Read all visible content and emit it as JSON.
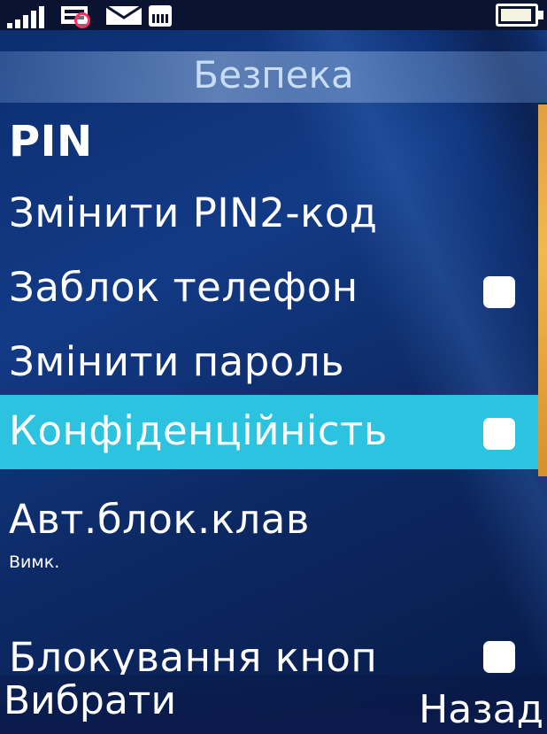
{
  "status_bar": {
    "icons": [
      "signal-icon",
      "network-icon",
      "mute-icon",
      "envelope-icon",
      "sim-card-icon",
      "battery-icon"
    ]
  },
  "header": {
    "title": "Безпека"
  },
  "menu": {
    "items": [
      {
        "label": "PIN",
        "has_checkbox": false
      },
      {
        "label": "Змінити PIN2-код",
        "has_checkbox": false
      },
      {
        "label": "Заблок телефон",
        "has_checkbox": true,
        "checked": false
      },
      {
        "label": "Змінити пароль",
        "has_checkbox": false
      },
      {
        "label": "Конфіденційність",
        "has_checkbox": true,
        "checked": false,
        "selected": true
      },
      {
        "label": "Авт.блок.клав",
        "sublabel": "Вимк.",
        "has_checkbox": false
      },
      {
        "label": "Блокування кноп",
        "has_checkbox": true,
        "checked": false
      }
    ]
  },
  "softkeys": {
    "left": "Вибрати",
    "right": "Назад"
  },
  "colors": {
    "selection": "#2bc3e0",
    "background": "#0c2d6e",
    "text": "#ffffff"
  }
}
